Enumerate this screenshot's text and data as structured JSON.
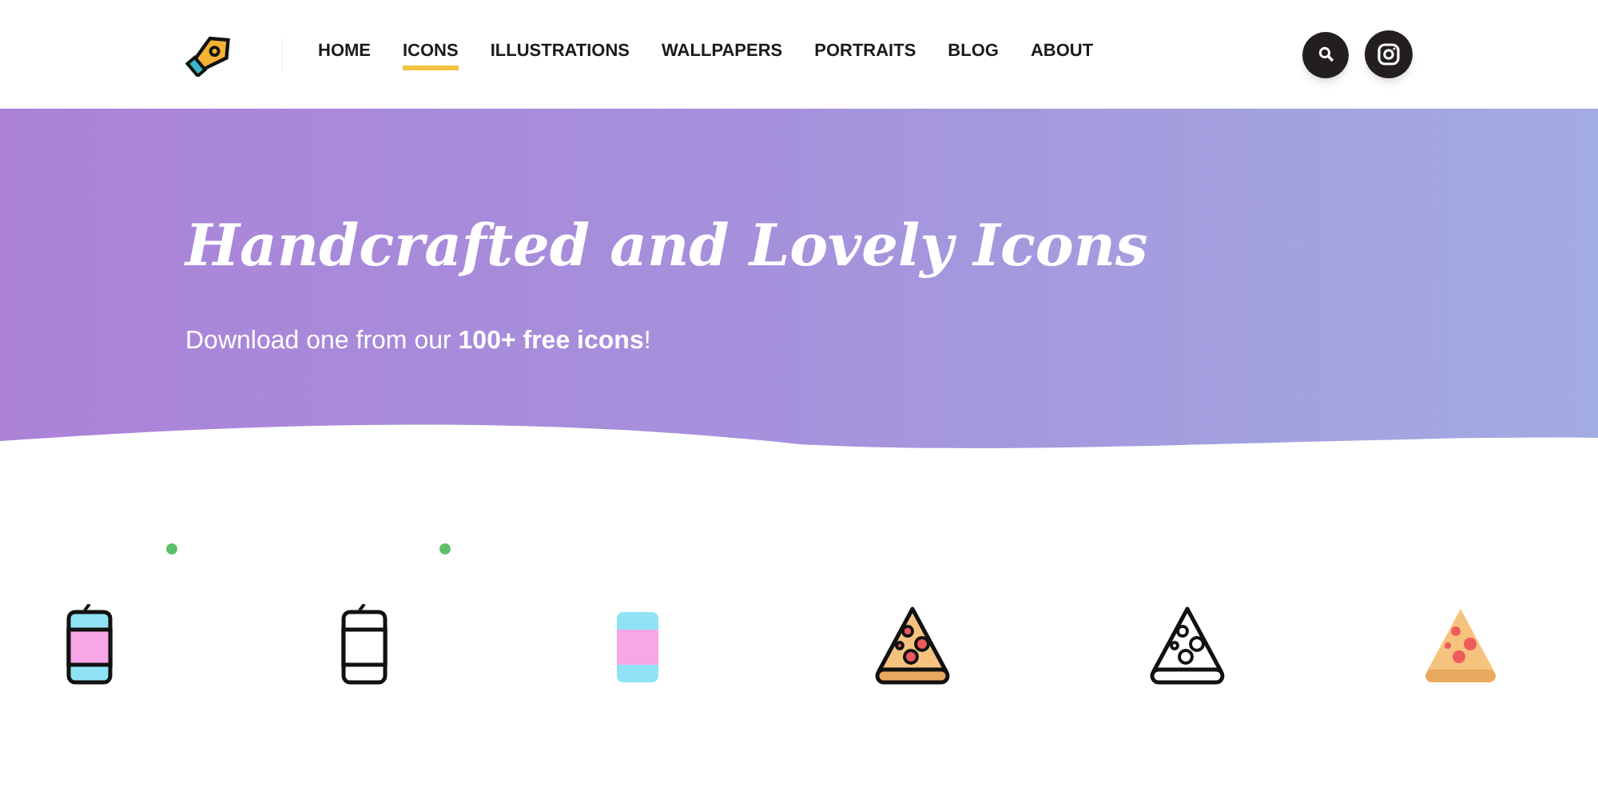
{
  "nav": {
    "items": [
      {
        "label": "HOME",
        "selected": false
      },
      {
        "label": "ICONS",
        "selected": true
      },
      {
        "label": "ILLUSTRATIONS",
        "selected": false
      },
      {
        "label": "WALLPAPERS",
        "selected": false
      },
      {
        "label": "PORTRAITS",
        "selected": false
      },
      {
        "label": "BLOG",
        "selected": false
      },
      {
        "label": "ABOUT",
        "selected": false
      }
    ]
  },
  "hero": {
    "title": "Handcrafted and Lovely Icons",
    "subtitle": "Download one from our **100+ free icons**!"
  },
  "icons": [
    {
      "kind": "can",
      "new": true
    },
    {
      "kind": "canline",
      "new": true
    },
    {
      "kind": "canflat",
      "new": false
    },
    {
      "kind": "pizza",
      "new": false
    },
    {
      "kind": "pizzaline",
      "new": false
    },
    {
      "kind": "pizzaflat",
      "new": false
    }
  ]
}
